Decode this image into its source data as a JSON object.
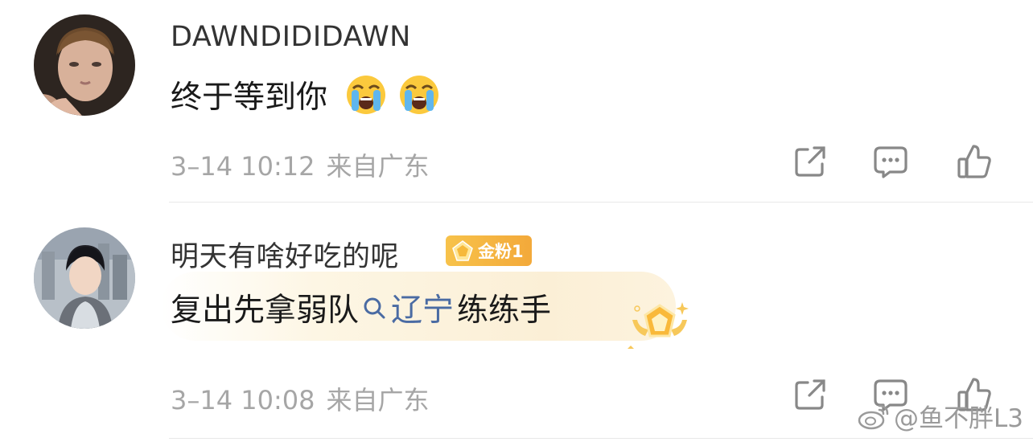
{
  "comments": [
    {
      "username": "DAWNDIDIDAWN",
      "text": "终于等到你",
      "emojis": [
        "loudly-crying-face",
        "loudly-crying-face"
      ],
      "time": "3–14 10:12",
      "location": "来自广东",
      "avatar": "avatar-photo-young-man"
    },
    {
      "username": "明天有啥好吃的呢",
      "badge": "金粉1",
      "text_before": "复出先拿弱队",
      "topic": "辽宁",
      "text_after": "练练手",
      "time": "3–14 10:08",
      "location": "来自广东",
      "avatar": "avatar-anime-boy"
    }
  ],
  "actions": [
    "share-icon",
    "comment-icon",
    "like-icon"
  ],
  "watermark": "@鱼不胖L3",
  "colors": {
    "topic": "#4a6ba3",
    "meta": "#a6a6a6",
    "badge": "#f3a93a"
  }
}
